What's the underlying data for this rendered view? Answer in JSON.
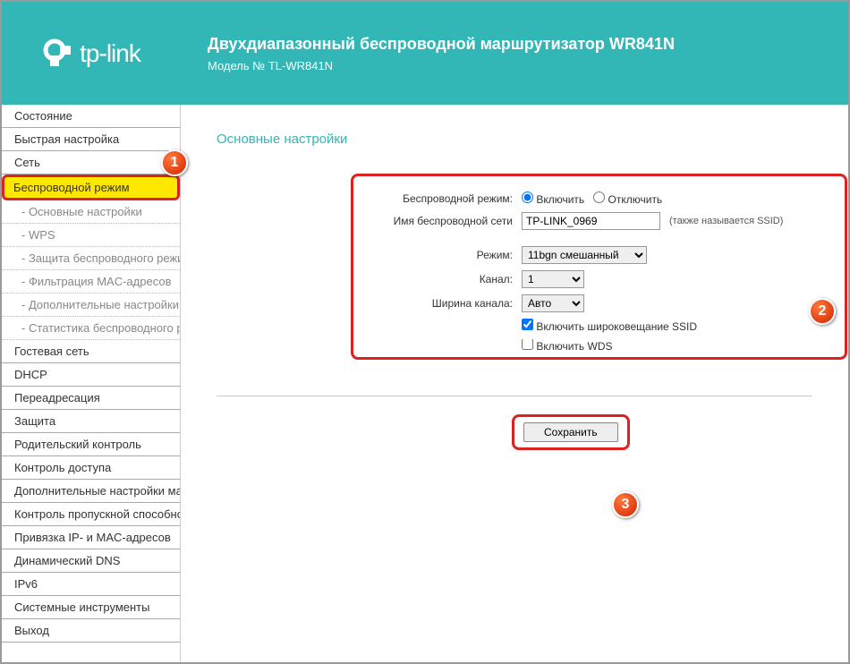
{
  "header": {
    "brand": "tp-link",
    "title": "Двухдиапазонный беспроводной маршрутизатор WR841N",
    "model_label": "Модель № TL-WR841N"
  },
  "sidebar": {
    "items": [
      {
        "label": "Состояние",
        "sub": false
      },
      {
        "label": "Быстрая настройка",
        "sub": false
      },
      {
        "label": "Сеть",
        "sub": false
      },
      {
        "label": "Беспроводной режим",
        "sub": false,
        "highlight": true
      },
      {
        "label": "- Основные настройки",
        "sub": true
      },
      {
        "label": "- WPS",
        "sub": true
      },
      {
        "label": "- Защита беспроводного режима",
        "sub": true
      },
      {
        "label": "- Фильтрация MAC-адресов",
        "sub": true
      },
      {
        "label": "- Дополнительные настройки",
        "sub": true
      },
      {
        "label": "- Статистика беспроводного режима",
        "sub": true
      },
      {
        "label": "Гостевая сеть",
        "sub": false
      },
      {
        "label": "DHCP",
        "sub": false
      },
      {
        "label": "Переадресация",
        "sub": false
      },
      {
        "label": "Защита",
        "sub": false
      },
      {
        "label": "Родительский контроль",
        "sub": false
      },
      {
        "label": "Контроль доступа",
        "sub": false
      },
      {
        "label": "Дополнительные настройки маршрутизации",
        "sub": false
      },
      {
        "label": "Контроль пропускной способности",
        "sub": false
      },
      {
        "label": "Привязка IP- и MAC-адресов",
        "sub": false
      },
      {
        "label": "Динамический DNS",
        "sub": false
      },
      {
        "label": "IPv6",
        "sub": false
      },
      {
        "label": "Системные инструменты",
        "sub": false
      },
      {
        "label": "Выход",
        "sub": false
      }
    ]
  },
  "content": {
    "section_title": "Основные настройки",
    "wireless_label": "Беспроводной режим:",
    "enable_label": "Включить",
    "disable_label": "Отключить",
    "ssid_label": "Имя беспроводной сети",
    "ssid_value": "TP-LINK_0969",
    "ssid_hint": "(также называется SSID)",
    "mode_label": "Режим:",
    "mode_value": "11bgn смешанный",
    "channel_label": "Канал:",
    "channel_value": "1",
    "width_label": "Ширина канала:",
    "width_value": "Авто",
    "broadcast_label": "Включить широковещание SSID",
    "wds_label": "Включить WDS",
    "save_button": "Сохранить"
  },
  "badges": {
    "one": "1",
    "two": "2",
    "three": "3"
  }
}
